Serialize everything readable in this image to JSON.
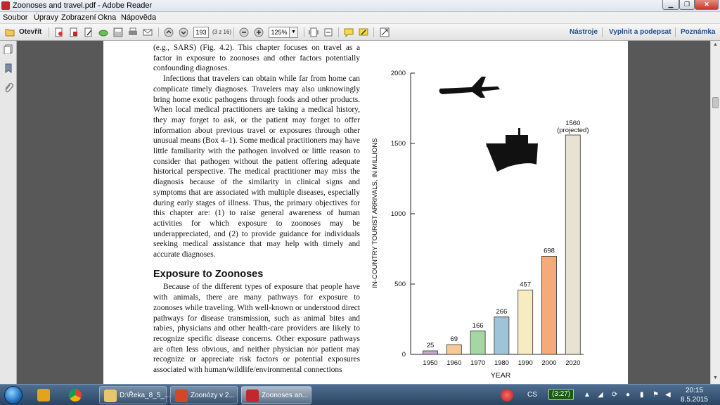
{
  "window": {
    "title": "Zoonoses and travel.pdf - Adobe Reader"
  },
  "menu": [
    "Soubor",
    "Úpravy",
    "Zobrazení",
    "Okna",
    "Nápověda"
  ],
  "toolbar": {
    "open_label": "Otevřít",
    "page_number": "193",
    "page_count": "(3 z 16)",
    "zoom": "125%",
    "right_links": [
      "Nástroje",
      "Vyplnit a podepsat",
      "Poznámka"
    ]
  },
  "document": {
    "paragraphs": [
      "(e.g., SARS) (Fig. 4.2). This chapter focuses on travel as a factor in exposure to zoonoses and other factors potentially confounding diagnoses.",
      "Infections that travelers can obtain while far from home can complicate timely diagnoses. Travelers may also unknowingly bring home exotic pathogens through foods and other products. When local medical practitioners are taking a medical history, they may forget to ask, or the patient may forget to offer information about previous travel or exposures through other unusual means (Box 4–1). Some medical practitioners may have little familiarity with the pathogen involved or little reason to consider that pathogen without the patient offering adequate historical perspective. The medical practitioner may miss the diagnosis because of the similarity in clinical signs and symptoms that are associated with multiple diseases, especially during early stages of illness. Thus, the primary objectives for this chapter are: (1) to raise general awareness of human activities for which exposure to zoonoses may be underappreciated, and (2) to provide guidance for individuals seeking medical assistance that may help with timely and accurate diagnoses.",
      "Because of the different types of exposure that people have with animals, there are many pathways for exposure to zoonoses while traveling. With well-known or understood direct pathways for disease transmission, such as animal bites and rabies, physicians and other health-care providers are likely to recognize specific disease concerns. Other exposure pathways are often less obvious, and neither physician nor patient may recognize or appreciate risk factors or potential exposures associated with human/wildlife/environmental connections"
    ],
    "section_heading": "Exposure to Zoonoses"
  },
  "chart_data": {
    "type": "bar",
    "categories": [
      "1950",
      "1960",
      "1970",
      "1980",
      "1990",
      "2000",
      "2020"
    ],
    "values": [
      25,
      69,
      166,
      266,
      457,
      698,
      1560
    ],
    "value_labels": [
      "25",
      "69",
      "166",
      "266",
      "457",
      "698",
      "1560"
    ],
    "annotation": "(projected)",
    "colors": [
      "#c9a6cf",
      "#f7c89a",
      "#a6d6a4",
      "#9fc4d8",
      "#f7ebc2",
      "#f4aa7a",
      "#e8e2d2"
    ],
    "xlabel": "YEAR",
    "ylabel": "IN-COUNTRY TOURIST ARRIVALS, IN MILLIONS",
    "ylim": [
      0,
      2000
    ],
    "yticks": [
      0,
      500,
      1000,
      1500,
      2000
    ],
    "icons": [
      "airplane-icon",
      "ship-icon"
    ]
  },
  "taskbar": {
    "apps": [
      {
        "label": "D:\\Řeka_8_5_...",
        "active": false
      },
      {
        "label": "Zoonózy v 2...",
        "active": false
      },
      {
        "label": "Zoonoses an...",
        "active": true
      }
    ],
    "language": "CS",
    "battery": "(3:27)",
    "time": "20:15",
    "date": "8.5.2015"
  }
}
